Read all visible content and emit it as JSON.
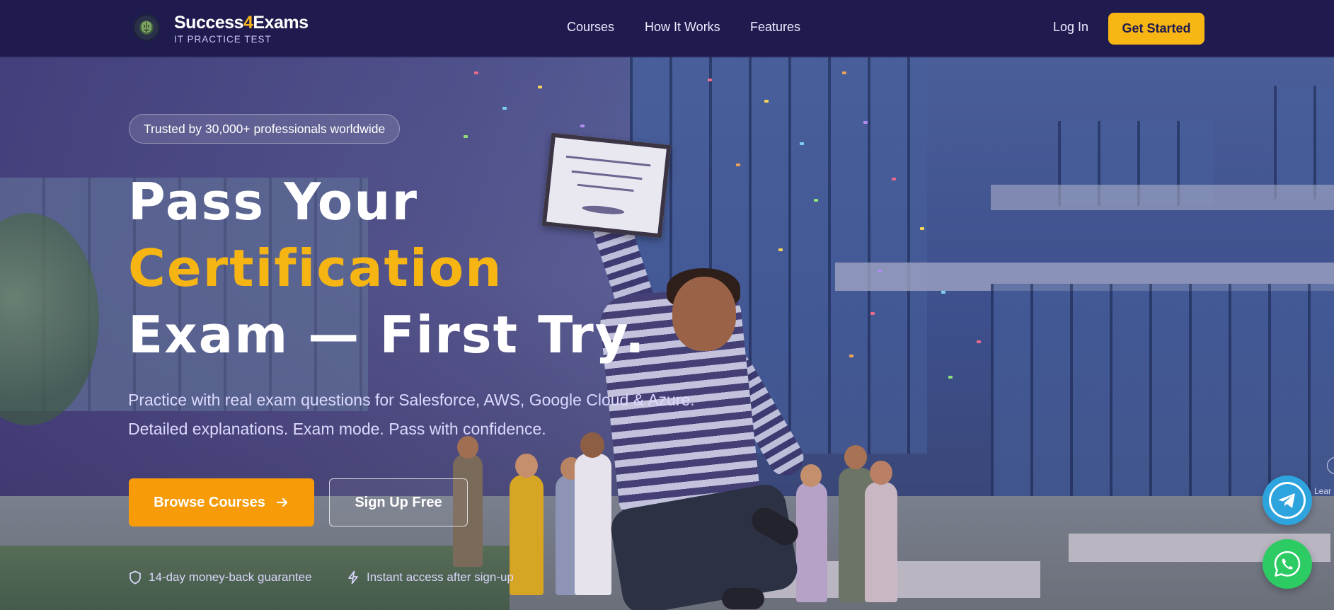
{
  "brand": {
    "name_part1": "Success",
    "name_accent": "4",
    "name_part2": "Exams",
    "tagline": "IT PRACTICE TEST"
  },
  "nav": {
    "links": [
      {
        "label": "Courses"
      },
      {
        "label": "How It Works"
      },
      {
        "label": "Features"
      }
    ],
    "login_label": "Log In",
    "cta_label": "Get Started"
  },
  "hero": {
    "trust_badge": "Trusted by 30,000+ professionals worldwide",
    "headline_line1": "Pass Your",
    "headline_line2": "Certification",
    "headline_line3": "Exam — First Try.",
    "subtitle": "Practice with real exam questions for Salesforce, AWS, Google Cloud & Azure. Detailed explanations. Exam mode. Pass with confidence.",
    "primary_button": "Browse Courses",
    "secondary_button": "Sign Up Free",
    "assurances": [
      {
        "icon": "shield-icon",
        "text": "14-day money-back guarantee"
      },
      {
        "icon": "lightning-icon",
        "text": "Instant access after sign-up"
      }
    ],
    "edge_label": "Lear"
  },
  "floating_actions": [
    {
      "icon": "telegram-icon",
      "color": "#2da4de"
    },
    {
      "icon": "whatsapp-icon",
      "color": "#2dcb63"
    }
  ],
  "colors": {
    "nav_bg": "#1f1b4e",
    "accent_yellow": "#f7b614",
    "accent_orange": "#f79b08"
  }
}
